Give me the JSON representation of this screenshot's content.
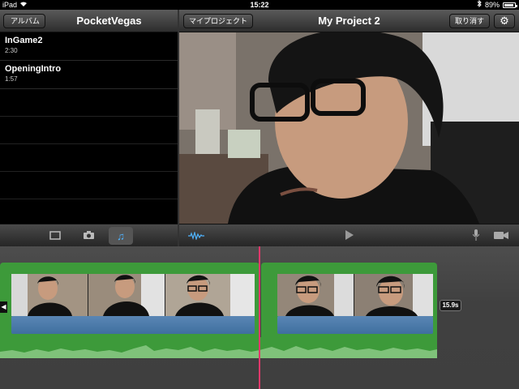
{
  "statusbar": {
    "device": "iPad",
    "time": "15:22",
    "battery": "89%"
  },
  "left_nav": {
    "back_label": "アルバム",
    "title": "PocketVegas"
  },
  "media_list": [
    {
      "name": "InGame2",
      "duration": "2:30"
    },
    {
      "name": "OpeningIntro",
      "duration": "1:57"
    }
  ],
  "right_nav": {
    "projects_label": "マイプロジェクト",
    "title": "My Project 2",
    "undo_label": "取り消す"
  },
  "left_toolbar": {
    "video_icon": "video-tab-icon",
    "photo_icon": "camera-icon",
    "music_icon": "music-note-icon",
    "active": "music"
  },
  "right_toolbar": {
    "waveform_icon": "waveform-icon",
    "play_icon": "play-icon",
    "mic_icon": "microphone-icon",
    "camera_icon": "video-camera-icon"
  },
  "timeline": {
    "clip2_duration": "15.9s"
  },
  "colors": {
    "clip_green": "#3d9a3a",
    "audio_blue": "#4a7aaa",
    "playhead": "#e0386b",
    "accent": "#4fb3ff"
  }
}
